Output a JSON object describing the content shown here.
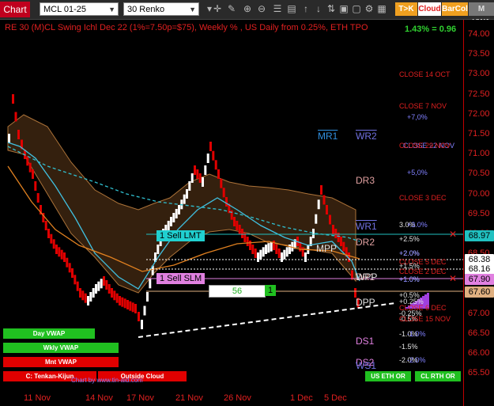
{
  "toolbar": {
    "chart_tab": "Chart",
    "instrument": "MCL 01-25",
    "bar_type": "30 Renko",
    "btn_tk": "T>K",
    "btn_cloud": "Cloud",
    "btn_barcol": "BarCol",
    "btn_mvwap": "M VWA",
    "icons": [
      "dropdown-icon",
      "crosshair-icon",
      "pencil-icon",
      "zoom-icon",
      "zoom-out-icon",
      "properties-icon",
      "data-box-icon",
      "arrow-up-icon",
      "arrow-down-icon",
      "arrow-lock-icon",
      "lock-icon",
      "unlock-icon",
      "strategy-icon",
      "chart-trader-icon"
    ]
  },
  "chart": {
    "title": "RE 30 (M)CL Swing Ichl Dec 22  (1%=7.50p=$75), Weekly % , US Daily from 0.25%, ETH TPO",
    "pnl": "1.43% = 0.96",
    "order_qty": "56",
    "order_one": "1",
    "sell_lmt": "1 Sell LMT",
    "sell_slm": "1 Sell SLM"
  },
  "yaxis": {
    "ticks": [
      "74.00",
      "73.50",
      "73.00",
      "72.50",
      "72.00",
      "71.50",
      "71.00",
      "70.50",
      "70.00",
      "69.50",
      "69.00",
      "68.50",
      "68.00",
      "67.50",
      "67.00",
      "66.50",
      "66.00",
      "65.50"
    ]
  },
  "price_tags": [
    {
      "value": "68.97",
      "bg": "#20c0c0"
    },
    {
      "value": "68.38",
      "bg": "#ffffff"
    },
    {
      "value": "68.16",
      "bg": "#ffffff"
    },
    {
      "value": "67.90",
      "bg": "#e080e0"
    },
    {
      "value": "67.60",
      "bg": "#e0b080"
    }
  ],
  "levels": [
    {
      "text": "MR1",
      "color": "#3090e0"
    },
    {
      "text": "WR2",
      "color": "#7070e0"
    },
    {
      "text": "DR3",
      "color": "#e0a0a0"
    },
    {
      "text": "WR1",
      "color": "#7070e0"
    },
    {
      "text": "DR2",
      "color": "#e0a0a0"
    },
    {
      "text": "MPP",
      "color": "#e0e0e0"
    },
    {
      "text": "DR1",
      "color": "#e0a0a0"
    },
    {
      "text": "WPP",
      "color": "#e0e0e0"
    },
    {
      "text": "DPP",
      "color": "#e0e0e0"
    },
    {
      "text": "DS1",
      "color": "#e080e0"
    },
    {
      "text": "DS2",
      "color": "#e080e0"
    },
    {
      "text": "WS1",
      "color": "#7070e0"
    }
  ],
  "right_labels": [
    {
      "text": "CLOSE 14 OCT",
      "color": "#e02020"
    },
    {
      "text": "CLOSE 7 NOV",
      "color": "#e02020"
    },
    {
      "text": "+7,0%",
      "color": "#8080ff"
    },
    {
      "text": "CLOSE 22 NOV",
      "color": "#8080ff"
    },
    {
      "text": "CLOSE 29 NOV",
      "color": "#e02020"
    },
    {
      "text": "+5,0%",
      "color": "#8080ff"
    },
    {
      "text": "CLOSE 3 DEC",
      "color": "#e02020"
    },
    {
      "text": "3.0%",
      "color": "#e0e0e0"
    },
    {
      "text": "+3.0%",
      "color": "#8080ff"
    },
    {
      "text": "+2.5%",
      "color": "#e0e0e0"
    },
    {
      "text": "+2.0%",
      "color": "#e0e0e0"
    },
    {
      "text": "+2.0%",
      "color": "#8080ff"
    },
    {
      "text": "CLOSE 5 DEC",
      "color": "#e02020"
    },
    {
      "text": "+1.5%",
      "color": "#e0e0e0"
    },
    {
      "text": "CLOSE 2 DEC",
      "color": "#e02020"
    },
    {
      "text": "+1.0%",
      "color": "#e0e0e0"
    },
    {
      "text": "+1.0%",
      "color": "#8080ff"
    },
    {
      "text": "+0.5%",
      "color": "#e0e0e0"
    },
    {
      "text": "+0.25%",
      "color": "#e0e0e0"
    },
    {
      "text": "CLOSE 6 DEC",
      "color": "#e02020"
    },
    {
      "text": "-0.25%",
      "color": "#e0e0e0"
    },
    {
      "text": "-0.5%",
      "color": "#e0e0e0"
    },
    {
      "text": "CLOSE 15 NOV",
      "color": "#e02020"
    },
    {
      "text": "-1.0%",
      "color": "#e0e0e0"
    },
    {
      "text": "-1.0%",
      "color": "#8080ff"
    },
    {
      "text": "-1.5%",
      "color": "#e0e0e0"
    },
    {
      "text": "-2.0%",
      "color": "#e0e0e0"
    },
    {
      "text": "-2.0%",
      "color": "#8080ff"
    }
  ],
  "xaxis": {
    "ticks": [
      "11 Nov",
      "14 Nov",
      "17 Nov",
      "21 Nov",
      "26 Nov",
      "1 Dec",
      "5 Dec"
    ]
  },
  "bottom_bars": [
    {
      "text": "Day VWAP",
      "bg": "#20c020"
    },
    {
      "text": "Wkly VWAP",
      "bg": "#20c020"
    },
    {
      "text": "Mnt VWAP",
      "bg": "#e00000"
    },
    {
      "text": "C: Tenkan-Kijun",
      "bg": "#e00000"
    },
    {
      "text": "Outside Cloud",
      "bg": "#e00000"
    }
  ],
  "eth_buttons": [
    {
      "text": "US ETH OR",
      "bg": "#20c020"
    },
    {
      "text": "CL RTH OR",
      "bg": "#20c020"
    }
  ],
  "watermark": "Chart by www.tin-aid.com",
  "colors": {
    "up_bar": "#ffffff",
    "down_bar": "#e00000",
    "cloud": "#c08040",
    "vwap_line": "#40c0e0",
    "tenkan": "#e08020",
    "accent": "#c0001e"
  }
}
